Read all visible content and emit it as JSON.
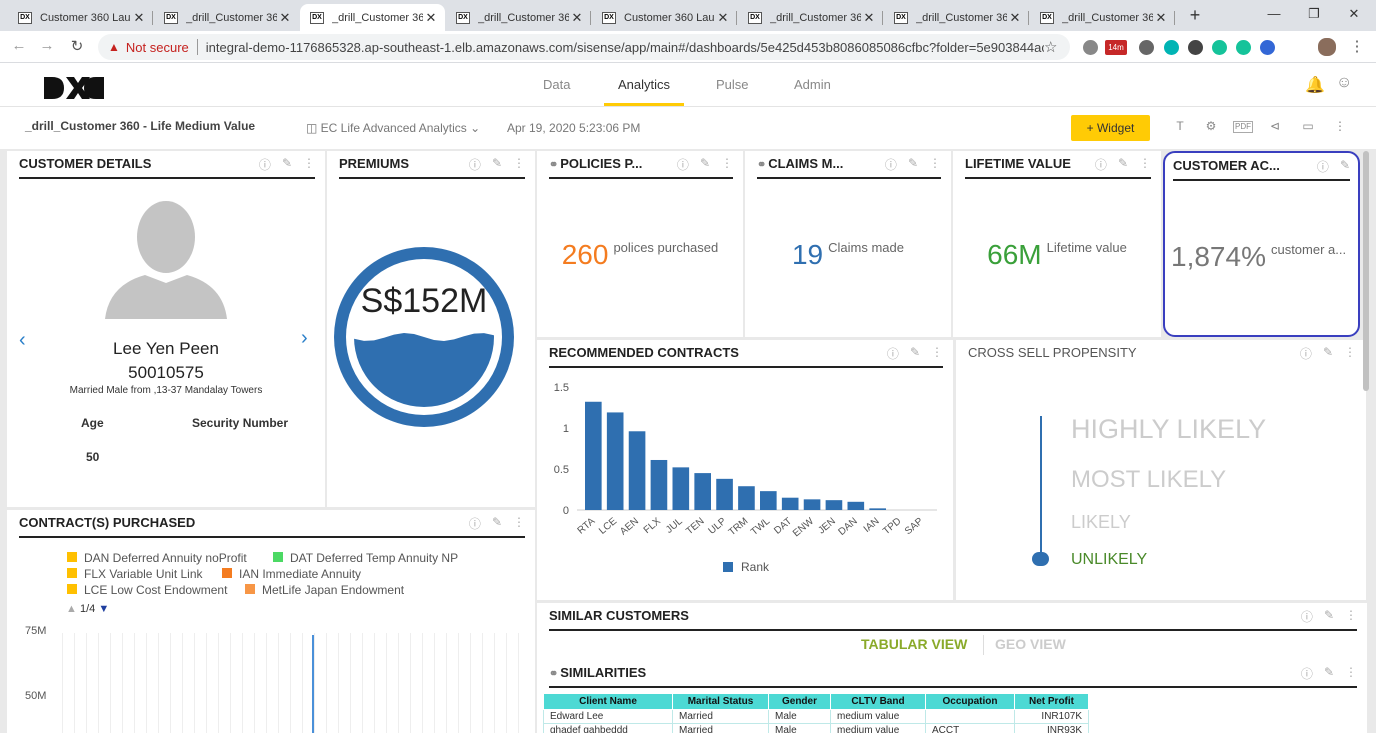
{
  "browser": {
    "tabs": [
      {
        "label": "Customer 360 Lau"
      },
      {
        "label": "_drill_Customer 36"
      },
      {
        "label": "_drill_Customer 36"
      },
      {
        "label": "_drill_Customer 36"
      },
      {
        "label": "Customer 360 Lau"
      },
      {
        "label": "_drill_Customer 36"
      },
      {
        "label": "_drill_Customer 36"
      },
      {
        "label": "_drill_Customer 36"
      }
    ],
    "active_tab": 2,
    "security_label": "Not secure",
    "url": "integral-demo-1176865328.ap-southeast-1.elb.amazonaws.com/sisense/app/main#/dashboards/5e425d453b8086085086cfbc?folder=5e903844ac7...",
    "badge": "14m"
  },
  "app": {
    "nav": [
      "Data",
      "Analytics",
      "Pulse",
      "Admin"
    ],
    "active_nav": "Analytics"
  },
  "dashboard": {
    "title": "_drill_Customer 360 - Life Medium Value",
    "source": "EC Life Advanced Analytics",
    "date": "Apr 19, 2020 5:23:06 PM",
    "widget_button": "Widget"
  },
  "customer": {
    "title": "CUSTOMER DETAILS",
    "name": "Lee Yen Peen",
    "id": "50010575",
    "desc": "Married Male from ,13-37 Mandalay Towers",
    "age_label": "Age",
    "security_label": "Security Number",
    "age": "50"
  },
  "premiums": {
    "title": "PREMIUMS",
    "value": "S$152M",
    "fill_fraction": 0.5
  },
  "kpis": [
    {
      "title": "POLICIES P...",
      "value": "260",
      "label": "polices purchased",
      "color": "#f47c20"
    },
    {
      "title": "CLAIMS M...",
      "value": "19",
      "label": "Claims made",
      "color": "#2f6fb0"
    },
    {
      "title": "LIFETIME VALUE",
      "value": "66M",
      "label": "Lifetime value",
      "color": "#3aa03a"
    },
    {
      "title": "CUSTOMER AC...",
      "value": "1,874%",
      "label": "customer a...",
      "color": "#777777"
    }
  ],
  "recommended": {
    "title": "RECOMMENDED CONTRACTS"
  },
  "chart_data": {
    "type": "bar",
    "categories": [
      "RTA",
      "LCE",
      "AEN",
      "FLX",
      "JUL",
      "TEN",
      "ULP",
      "TRM",
      "TWL",
      "DAT",
      "ENW",
      "JEN",
      "DAN",
      "IAN",
      "TPD",
      "SAP"
    ],
    "series": [
      {
        "name": "Rank",
        "values": [
          1.32,
          1.19,
          0.96,
          0.61,
          0.52,
          0.45,
          0.38,
          0.29,
          0.23,
          0.15,
          0.13,
          0.12,
          0.1,
          0.02,
          0.0,
          0.0
        ],
        "color": "#2f6fb0"
      }
    ],
    "yticks": [
      "0",
      "0.5",
      "1",
      "1.5"
    ],
    "ylim": [
      0,
      1.5
    ]
  },
  "cross_sell": {
    "title": "CROSS SELL PROPENSITY",
    "levels": [
      "HIGHLY LIKELY",
      "MOST LIKELY",
      "LIKELY",
      "UNLIKELY"
    ],
    "active": "UNLIKELY"
  },
  "contracts": {
    "title": "CONTRACT(S) PURCHASED",
    "legend": [
      {
        "label": "DAN Deferred Annuity noProfit",
        "color": "#ffc000"
      },
      {
        "label": "DAT Deferred Temp Annuity NP",
        "color": "#4cd964"
      },
      {
        "label": "FLX Variable Unit Link",
        "color": "#ffc000"
      },
      {
        "label": "IAN Immediate Annuity",
        "color": "#f47c20"
      },
      {
        "label": "LCE Low Cost Endowment",
        "color": "#ffc000"
      },
      {
        "label": "MetLife Japan Endowment",
        "color": "#f79646"
      }
    ],
    "pager": "1/4",
    "yticks": [
      "75M",
      "50M"
    ]
  },
  "similar": {
    "title": "SIMILAR CUSTOMERS",
    "tab_tabular": "TABULAR VIEW",
    "tab_geo": "GEO VIEW"
  },
  "similarities": {
    "title": "SIMILARITIES",
    "columns": [
      "Client Name",
      "Marital Status",
      "Gender",
      "CLTV Band",
      "Occupation",
      "Net Profit"
    ],
    "rows": [
      [
        "Edward Lee",
        "Married",
        "Male",
        "medium value",
        "",
        "INR107K"
      ],
      [
        "ghadef gahbeddd",
        "Married",
        "Male",
        "medium value",
        "ACCT",
        "INR93K"
      ]
    ]
  }
}
